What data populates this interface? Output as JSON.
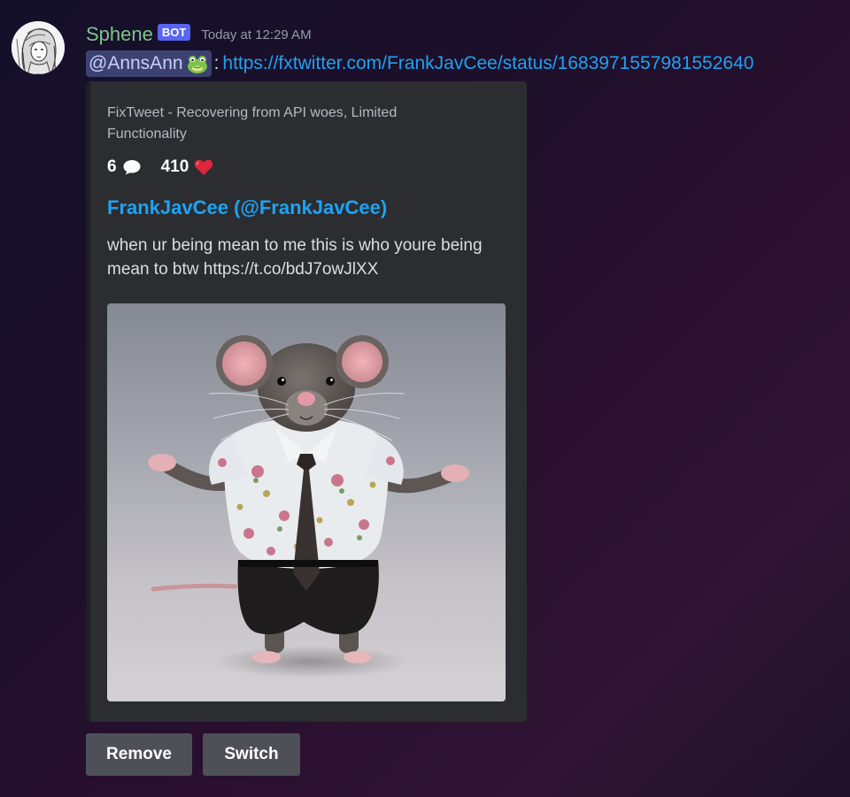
{
  "message": {
    "author": {
      "username": "Sphene",
      "bot_tag": "BOT",
      "avatar_icon": "anime-girl-sketch-avatar"
    },
    "timestamp": "Today at 12:29 AM",
    "mention": {
      "text": "@AnnsAnn",
      "emoji_icon": "frog-emoji"
    },
    "separator": ":",
    "link": {
      "text": "https://fxtwitter.com/FrankJavCee/status/1683971557981552640"
    }
  },
  "embed": {
    "provider": "FixTweet - Recovering from API woes, Limited Functionality",
    "stats": {
      "replies": "6",
      "replies_icon": "speech-bubble-icon",
      "likes": "410",
      "likes_icon": "red-heart-icon"
    },
    "author": "FrankJavCee (@FrankJavCee)",
    "description": "when ur being mean to me this is who youre being mean to btw https://t.co/bdJ7owJlXX",
    "image": {
      "icon": "rat-in-floral-shirt-and-tie-image"
    }
  },
  "buttons": {
    "remove": "Remove",
    "switch": "Switch"
  },
  "colors": {
    "username": "#7fc48a",
    "bot_tag": "#5865f2",
    "link": "#1fa2f2",
    "embed_bg": "#2b2d31",
    "button_bg": "#4e5058"
  }
}
